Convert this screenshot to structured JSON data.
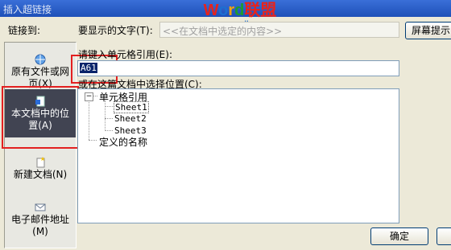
{
  "window": {
    "title": "插入超链接"
  },
  "watermark": {
    "brand_w": "W",
    "brand_o": "o",
    "brand_r": "r",
    "brand_d": "d",
    "brand_cn": "联盟",
    "url": "www.wordlm.com"
  },
  "link_to": {
    "label": "链接到:"
  },
  "display_text": {
    "label": "要显示的文字(T):",
    "value": "<<在文档中选定的内容>>"
  },
  "screen_tip_button": "屏幕提示",
  "sidebar": {
    "items": [
      {
        "label": "原有文件或网页(X)"
      },
      {
        "label": "本文档中的位置(A)",
        "selected": true
      },
      {
        "label": "新建文档(N)"
      },
      {
        "label": "电子邮件地址(M)"
      }
    ]
  },
  "cell_ref": {
    "label": "请键入单元格引用(E):",
    "value": "A61"
  },
  "location": {
    "label": "或在这篇文档中选择位置(C):"
  },
  "tree": {
    "cell_refs": {
      "label": "单元格引用",
      "toggle": "−"
    },
    "sheets": [
      "Sheet1",
      "Sheet2",
      "Sheet3"
    ],
    "defined_names": {
      "label": "定义的名称"
    }
  },
  "ok_button": "确定",
  "colors": {
    "highlight": "#E32020",
    "selected_bg": "#414452",
    "titlebar": "#1E50B8"
  }
}
